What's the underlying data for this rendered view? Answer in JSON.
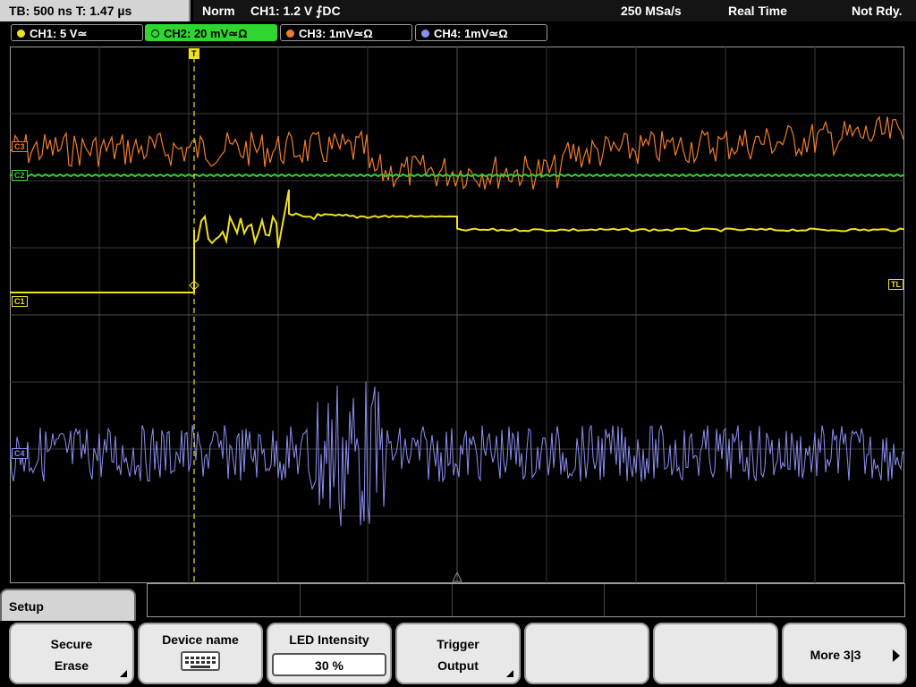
{
  "top": {
    "timebase": "TB: 500 ns   T: 1.47 µs",
    "mode": "Norm",
    "trigger": "CH1: 1.2 V ⨍DC",
    "sample_rate": "250 MSa/s",
    "acq": "Real Time",
    "state": "Not Rdy."
  },
  "channels": [
    {
      "label": "CH1: 5 V≃",
      "color": "#f0e020"
    },
    {
      "label": "CH2: 20 mV≃Ω",
      "color": "#2fd62f"
    },
    {
      "label": "CH3: 1mV≃Ω",
      "color": "#f07d2a"
    },
    {
      "label": "CH4: 1mV≃Ω",
      "color": "#8c8ef0"
    }
  ],
  "markers": {
    "c1": "C1",
    "c2": "C2",
    "c3": "C3",
    "c4": "C4",
    "tl": "TL",
    "trig": "T"
  },
  "menu": {
    "title": "Setup"
  },
  "softkeys": {
    "secure": {
      "l1": "Secure",
      "l2": "Erase"
    },
    "device": {
      "l1": "Device name"
    },
    "led": {
      "l1": "LED Intensity",
      "value": "30 %"
    },
    "trigger_out": {
      "l1": "Trigger",
      "l2": "Output"
    },
    "more": {
      "l1": "More 3|3"
    }
  }
}
